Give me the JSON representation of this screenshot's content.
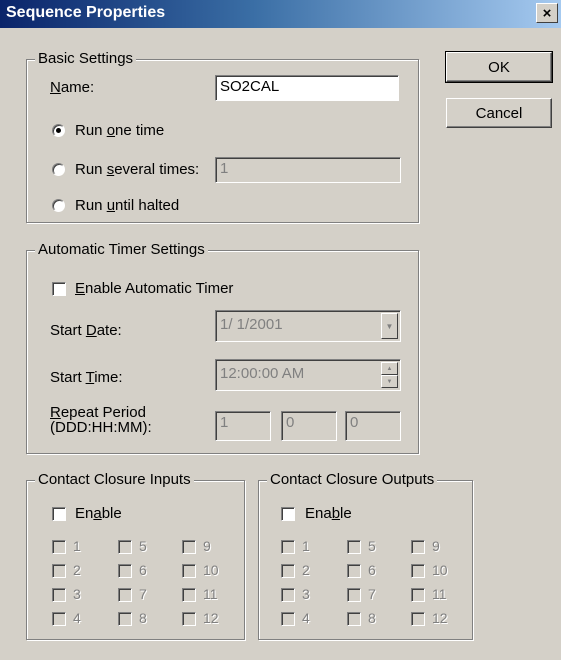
{
  "window": {
    "title": "Sequence Properties",
    "close_glyph": "×"
  },
  "buttons": {
    "ok": "OK",
    "cancel": "Cancel"
  },
  "basic": {
    "legend": "Basic Settings",
    "name_label_pre": "",
    "name_label_acc": "N",
    "name_label_post": "ame:",
    "name_value": "SO2CAL",
    "run_one": {
      "pre": "Run ",
      "acc": "o",
      "post": "ne time",
      "selected": true
    },
    "run_several": {
      "pre": "Run ",
      "acc": "s",
      "post": "everal times:",
      "selected": false
    },
    "run_several_value": "1",
    "run_until": {
      "pre": "Run ",
      "acc": "u",
      "post": "ntil halted",
      "selected": false
    }
  },
  "timer": {
    "legend": "Automatic Timer Settings",
    "enable": {
      "pre": "",
      "acc": "E",
      "post": "nable Automatic Timer",
      "checked": false
    },
    "start_date": {
      "pre": "Start ",
      "acc": "D",
      "post": "ate:",
      "value": "1/ 1/2001"
    },
    "start_time": {
      "pre": "Start ",
      "acc": "T",
      "post": "ime:",
      "value": "12:00:00 AM"
    },
    "repeat": {
      "line1_pre": "",
      "line1_acc": "R",
      "line1_post": "epeat Period",
      "line2": "(DDD:HH:MM):",
      "ddd": "1",
      "hh": "0",
      "mm": "0"
    }
  },
  "inputs": {
    "legend": "Contact Closure Inputs",
    "enable": {
      "pre": "En",
      "acc": "a",
      "post": "ble",
      "checked": false
    },
    "channels": [
      "1",
      "2",
      "3",
      "4",
      "5",
      "6",
      "7",
      "8",
      "9",
      "10",
      "11",
      "12"
    ]
  },
  "outputs": {
    "legend": "Contact Closure Outputs",
    "enable": {
      "pre": "Ena",
      "acc": "b",
      "post": "le",
      "checked": false
    },
    "channels": [
      "1",
      "2",
      "3",
      "4",
      "5",
      "6",
      "7",
      "8",
      "9",
      "10",
      "11",
      "12"
    ]
  },
  "icons": {
    "dropdown_arrow": "▼",
    "spin_up": "▲",
    "spin_down": "▼"
  }
}
